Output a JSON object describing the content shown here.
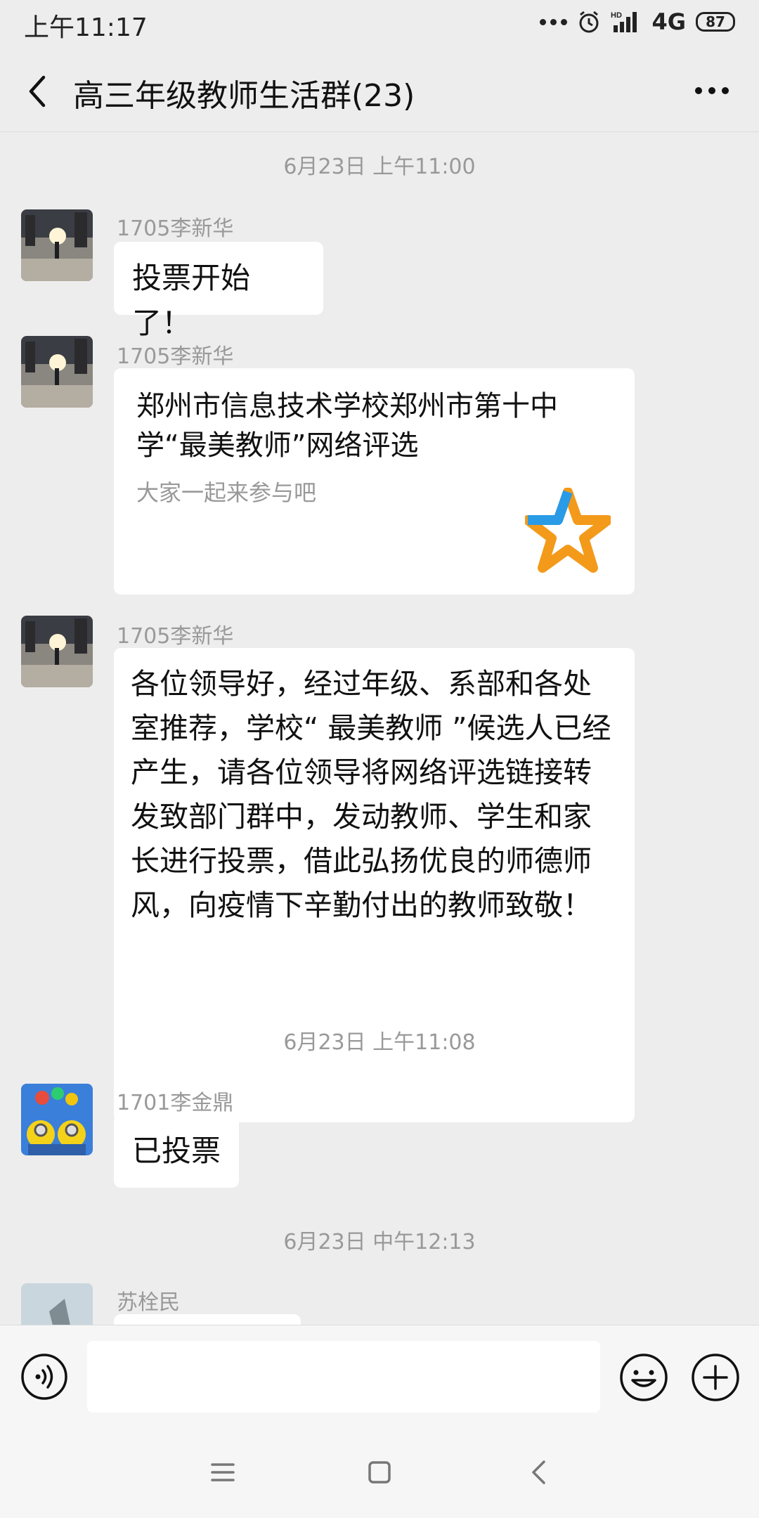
{
  "status_bar": {
    "time": "上午11:17",
    "network": "4G",
    "battery": "87",
    "icons": [
      "more-dots-icon",
      "alarm-icon",
      "hd-icon",
      "signal-icon",
      "battery-icon"
    ]
  },
  "header": {
    "title": "高三年级教师生活群(23)",
    "back_icon": "back-arrow-icon",
    "more_icon": "more-icon"
  },
  "messages": [
    {
      "type": "timestamp",
      "text": "6月23日 上午11:00"
    },
    {
      "type": "text",
      "sender": "1705李新华",
      "text": "投票开始了！",
      "avatar": "landscape"
    },
    {
      "type": "card",
      "sender": "1705李新华",
      "avatar": "landscape",
      "title": "郑州市信息技术学校郑州市第十中学“最美教师”网络评选",
      "description": "大家一起来参与吧",
      "icon": "star-logo-icon"
    },
    {
      "type": "text",
      "sender": "1705李新华",
      "avatar": "landscape",
      "text": "各位领导好，经过年级、系部和各处室推荐，学校“ 最美教师 ”候选人已经产生，请各位领导将网络评选链接转发致部门群中，发动教师、学生和家长进行投票，借此弘扬优良的师德师风，向疫情下辛勤付出的教师致敬！"
    },
    {
      "type": "timestamp",
      "text": "6月23日 上午11:08"
    },
    {
      "type": "text",
      "sender": "1701李金鼎",
      "text": "已投票",
      "avatar": "minions"
    },
    {
      "type": "timestamp",
      "text": "6月23日 中午12:13"
    },
    {
      "type": "text",
      "sender": "苏栓民",
      "text": "",
      "avatar": "sky"
    }
  ],
  "input_bar": {
    "placeholder": "",
    "voice_icon": "voice-icon",
    "emoji_icon": "emoji-icon",
    "plus_icon": "plus-icon"
  },
  "system_nav": {
    "icons": [
      "menu-icon",
      "home-icon",
      "back-icon"
    ]
  },
  "colors": {
    "background": "#ededed",
    "bubble": "#ffffff",
    "meta_text": "#999999",
    "star_orange": "#f39a1a",
    "star_blue": "#2a9be6"
  }
}
